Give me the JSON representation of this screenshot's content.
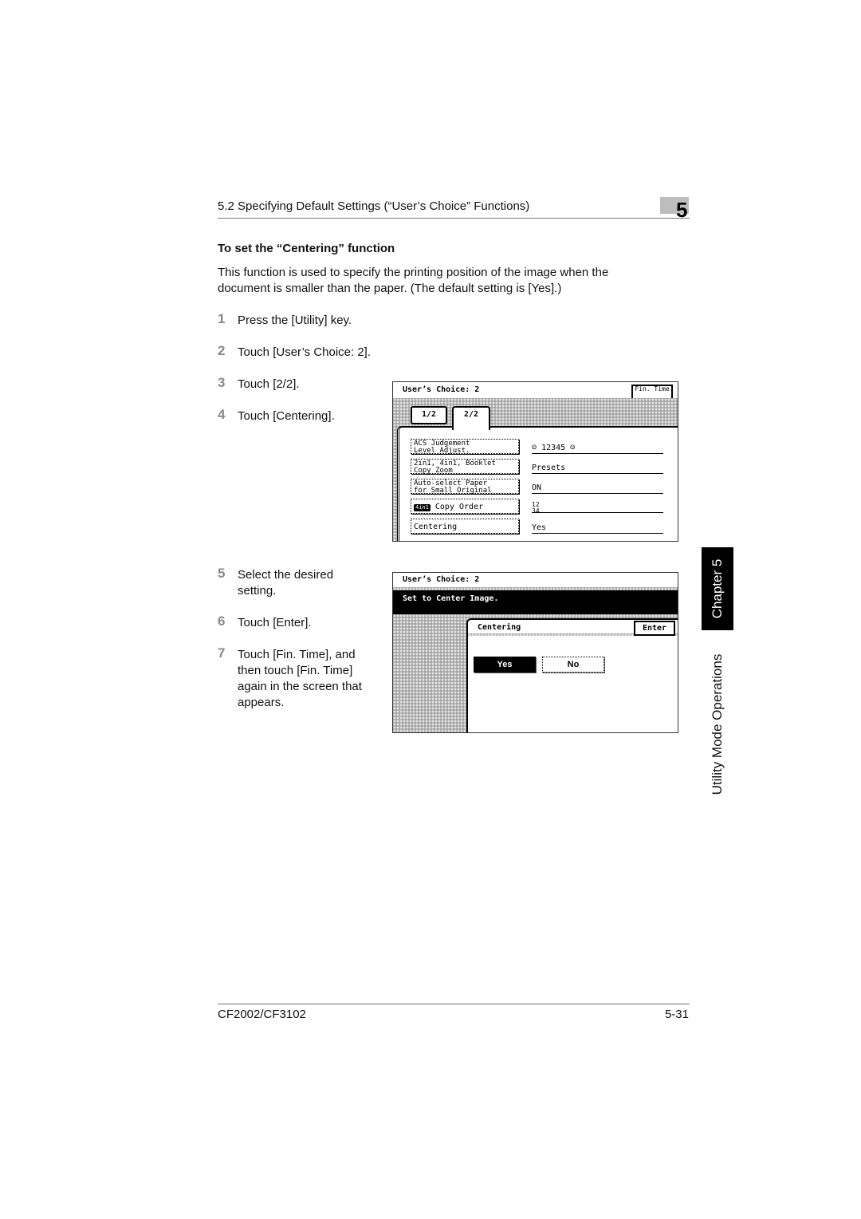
{
  "header": {
    "section_title": "5.2 Specifying Default Settings (“User’s Choice” Functions)",
    "chapter_number": "5"
  },
  "section": {
    "title": "To set the “Centering” function",
    "intro": "This function is used to specify the printing position of the image when the document is smaller than the paper. (The default setting is [Yes].)"
  },
  "steps": [
    {
      "num": "1",
      "text": "Press the [Utility] key."
    },
    {
      "num": "2",
      "text": "Touch [User’s Choice: 2]."
    },
    {
      "num": "3",
      "text": "Touch [2/2]."
    },
    {
      "num": "4",
      "text": "Touch [Centering]."
    },
    {
      "num": "5",
      "text": "Select the desired setting."
    },
    {
      "num": "6",
      "text": "Touch [Enter]."
    },
    {
      "num": "7",
      "text": "Touch [Fin. Time], and then touch [Fin. Time] again in the screen that appears."
    }
  ],
  "screen1": {
    "title": "User’s Choice: 2",
    "fin_time_label": "Fin. Time",
    "tabs": [
      {
        "label": "1/2",
        "active": false
      },
      {
        "label": "2/2",
        "active": true
      }
    ],
    "functions": [
      {
        "line1": "ACS Judgement",
        "line2": "Level Adjust.",
        "value": "12345",
        "value_highlight": "3"
      },
      {
        "line1": "2in1, 4in1, Booklet",
        "line2": "Copy Zoom",
        "value": "Presets"
      },
      {
        "line1": "Auto-select Paper",
        "line2": "for Small Original",
        "value": "ON"
      },
      {
        "badge": "4in1",
        "line1": "Copy Order",
        "value_top": "12",
        "value_bottom": "34"
      },
      {
        "line1": "Centering",
        "value": "Yes"
      }
    ]
  },
  "screen2": {
    "title": "User’s Choice: 2",
    "message": "Set to Center Image.",
    "panel_title": "Centering",
    "enter_label": "Enter",
    "options": [
      {
        "label": "Yes",
        "selected": true
      },
      {
        "label": "No",
        "selected": false
      }
    ]
  },
  "side_tab": {
    "chapter": "Chapter 5",
    "section": "Utility Mode Operations"
  },
  "footer": {
    "model": "CF2002/CF3102",
    "page": "5-31"
  }
}
